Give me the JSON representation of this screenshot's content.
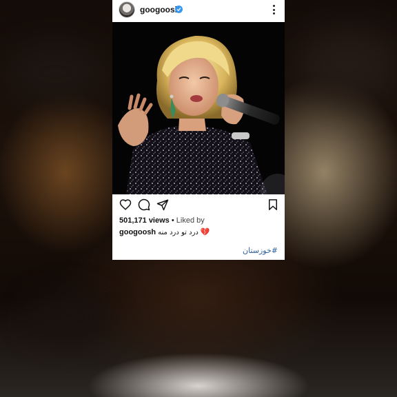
{
  "post": {
    "username": "googoosh",
    "verified": true,
    "views_count": "501,171 views",
    "views_separator": " • ",
    "liked_by_prefix": "Liked by",
    "caption_user": "googoosh",
    "caption_text": "درد تو درد منه",
    "caption_emoji": "💔",
    "hashtag": "#خوزستان"
  },
  "icons": {
    "avatar": "profile-avatar",
    "verified": "verified-badge-icon",
    "more": "more-options-icon",
    "like": "heart-icon",
    "comment": "comment-icon",
    "share": "send-icon",
    "save": "bookmark-icon"
  },
  "colors": {
    "verified_blue": "#3897f0",
    "hashtag_blue": "#2b5f9e",
    "card_background": "#ffffff",
    "photo_background": "#040404"
  }
}
